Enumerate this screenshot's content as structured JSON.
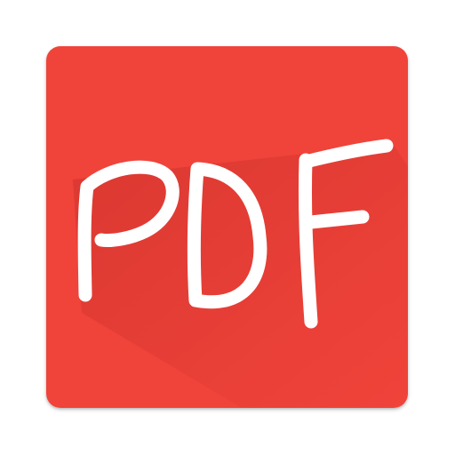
{
  "icon": {
    "text": "PDF",
    "background_color": "#f0433a",
    "shadow_color": "#c9302a",
    "letter_color": "#ffffff"
  }
}
